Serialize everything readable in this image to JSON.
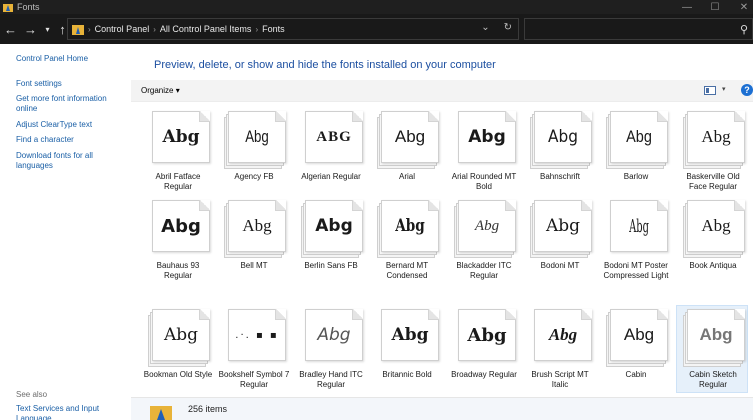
{
  "window": {
    "title": "Fonts"
  },
  "address": {
    "segments": [
      "Control Panel",
      "All Control Panel Items",
      "Fonts"
    ]
  },
  "leftpane": {
    "home": "Control Panel Home",
    "links": [
      "Font settings",
      "Get more font information online",
      "Adjust ClearType text",
      "Find a character",
      "Download fonts for all languages"
    ],
    "see_also": "See also",
    "see_also_links": [
      "Text Services and Input Language"
    ]
  },
  "content": {
    "heading": "Preview, delete, or show and hide the fonts installed on your computer",
    "organize": "Organize",
    "help": "?"
  },
  "fonts": [
    {
      "name": "Abril Fatface Regular",
      "sample": "Abg"
    },
    {
      "name": "Agency FB",
      "sample": "Abg"
    },
    {
      "name": "Algerian Regular",
      "sample": "ABG"
    },
    {
      "name": "Arial",
      "sample": "Abg"
    },
    {
      "name": "Arial Rounded MT Bold",
      "sample": "Abg"
    },
    {
      "name": "Bahnschrift",
      "sample": "Abg"
    },
    {
      "name": "Barlow",
      "sample": "Abg"
    },
    {
      "name": "Baskerville Old Face Regular",
      "sample": "Abg"
    },
    {
      "name": "Bauhaus 93 Regular",
      "sample": "Abg"
    },
    {
      "name": "Bell MT",
      "sample": "Abg"
    },
    {
      "name": "Berlin Sans FB",
      "sample": "Abg"
    },
    {
      "name": "Bernard MT Condensed",
      "sample": "Abg"
    },
    {
      "name": "Blackadder ITC Regular",
      "sample": "Abg"
    },
    {
      "name": "Bodoni MT",
      "sample": "Abg"
    },
    {
      "name": "Bodoni MT Poster Compressed Light",
      "sample": "Abg"
    },
    {
      "name": "Book Antiqua",
      "sample": "Abg"
    },
    {
      "name": "Bookman Old Style",
      "sample": "Abg"
    },
    {
      "name": "Bookshelf Symbol 7 Regular",
      "sample": ".·. ▪ ▪"
    },
    {
      "name": "Bradley Hand ITC Regular",
      "sample": "Abg"
    },
    {
      "name": "Britannic Bold",
      "sample": "Abg"
    },
    {
      "name": "Broadway Regular",
      "sample": "Abg"
    },
    {
      "name": "Brush Script MT Italic",
      "sample": "Abg"
    },
    {
      "name": "Cabin",
      "sample": "Abg"
    },
    {
      "name": "Cabin Sketch Regular",
      "sample": "Abg"
    }
  ],
  "status": {
    "count": "256 items"
  }
}
